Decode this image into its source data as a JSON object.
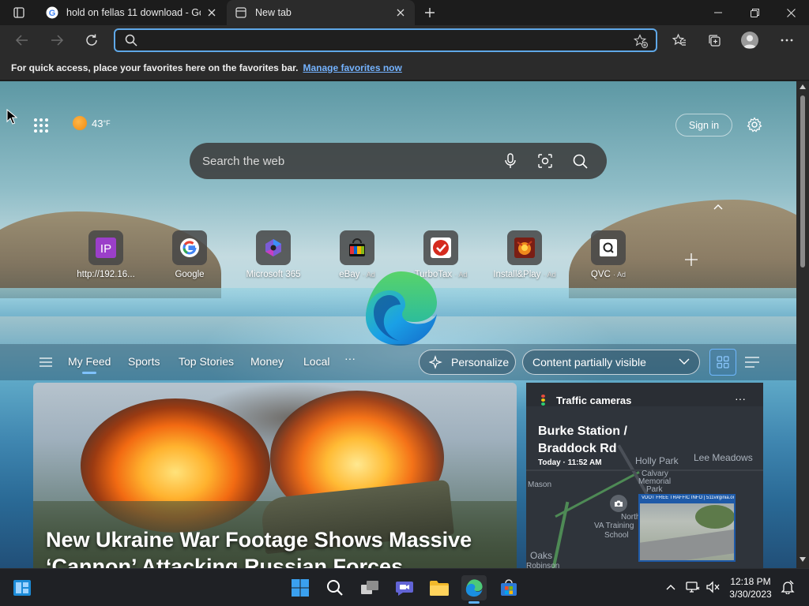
{
  "browser": {
    "tabs": [
      {
        "title": "hold on fellas 11 download - Google",
        "active": false
      },
      {
        "title": "New tab",
        "active": true
      }
    ],
    "address_value": "",
    "favorites_bar": {
      "message": "For quick access, place your favorites here on the favorites bar.",
      "link": "Manage favorites now"
    }
  },
  "newtab": {
    "weather": {
      "temp": "43",
      "unit": "°F"
    },
    "signin_label": "Sign in",
    "search_placeholder": "Search the web",
    "quick_links": [
      {
        "label": "http://192.16...",
        "ad": "",
        "icon": "ip-icon"
      },
      {
        "label": "Google",
        "ad": "",
        "icon": "google-icon"
      },
      {
        "label": "Microsoft 365",
        "ad": "",
        "icon": "microsoft-365-icon"
      },
      {
        "label": "eBay",
        "ad": "· Ad",
        "icon": "ebay-icon"
      },
      {
        "label": "TurboTax",
        "ad": "· Ad",
        "icon": "turbotax-icon"
      },
      {
        "label": "Install&Play",
        "ad": "· Ad",
        "icon": "install-play-icon"
      },
      {
        "label": "QVC",
        "ad": "· Ad",
        "icon": "qvc-icon"
      }
    ],
    "feed_nav": {
      "items": [
        "My Feed",
        "Sports",
        "Top Stories",
        "Money",
        "Local"
      ],
      "more": "···",
      "personalize": "Personalize",
      "content_visibility": "Content partially visible"
    },
    "hero": {
      "headline": "New Ukraine War Footage Shows Massive ‘Cannon’ Attacking Russian Forces"
    },
    "traffic_card": {
      "title": "Traffic cameras",
      "more": "···",
      "location_line1": "Burke Station /",
      "location_line2": "Braddock Rd",
      "time": "Today · 11:52 AM",
      "map_labels": [
        "Holly Park",
        "Lee Meadows",
        "Calvary",
        "Memorial",
        "Park",
        "Northern",
        "VA Training",
        "School",
        "Oaks",
        "Robinson",
        "Mason"
      ],
      "camera_banner": "VDOT FREE TRAFFIC INFO | 511virginia.org"
    }
  },
  "taskbar": {
    "clock_time": "12:18 PM",
    "clock_date": "3/30/2023"
  },
  "colors": {
    "accent": "#5fa8e8",
    "link": "#74b3ff"
  }
}
